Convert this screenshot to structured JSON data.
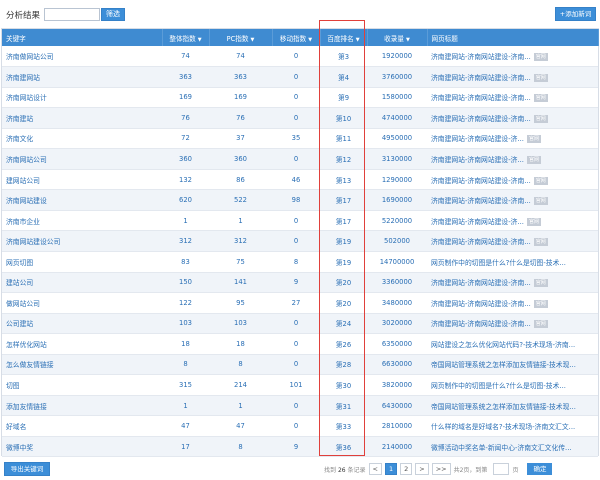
{
  "header": {
    "title": "分析结果",
    "filter_placeholder": "",
    "filter_button": "筛选",
    "add_button": "+添加新词"
  },
  "table": {
    "columns": [
      {
        "label": "关键字",
        "sort": ""
      },
      {
        "label": "整体指数",
        "sort": "▼"
      },
      {
        "label": "PC指数",
        "sort": "▼"
      },
      {
        "label": "移动指数",
        "sort": "▼"
      },
      {
        "label": "百度排名",
        "sort": "▼"
      },
      {
        "label": "收录量",
        "sort": "▼"
      },
      {
        "label": "网页标题",
        "sort": ""
      }
    ],
    "rows": [
      {
        "kw": "济南做网站公司",
        "all": "74",
        "pc": "74",
        "mobile": "0",
        "rank": "第3",
        "count": "1920000",
        "title": "济南建网站-济南网站建设-济南...",
        "tag": "官网"
      },
      {
        "kw": "济南建网站",
        "all": "363",
        "pc": "363",
        "mobile": "0",
        "rank": "第4",
        "count": "3760000",
        "title": "济南建网站-济南网站建设-济南...",
        "tag": "官网"
      },
      {
        "kw": "济南网站设计",
        "all": "169",
        "pc": "169",
        "mobile": "0",
        "rank": "第9",
        "count": "1580000",
        "title": "济南建网站-济南网站建设-济南...",
        "tag": "官网"
      },
      {
        "kw": "济南建站",
        "all": "76",
        "pc": "76",
        "mobile": "0",
        "rank": "第10",
        "count": "4740000",
        "title": "济南建网站-济南网站建设-济南...",
        "tag": "官网"
      },
      {
        "kw": "济南文化",
        "all": "72",
        "pc": "37",
        "mobile": "35",
        "rank": "第11",
        "count": "4950000",
        "title": "济南建网站-济南网站建设-济...",
        "tag": "官网"
      },
      {
        "kw": "济南网站公司",
        "all": "360",
        "pc": "360",
        "mobile": "0",
        "rank": "第12",
        "count": "3130000",
        "title": "济南建网站-济南网站建设-济...",
        "tag": "官网"
      },
      {
        "kw": "建网站公司",
        "all": "132",
        "pc": "86",
        "mobile": "46",
        "rank": "第13",
        "count": "1290000",
        "title": "济南建网站-济南网站建设-济南...",
        "tag": "官网"
      },
      {
        "kw": "济南网站建设",
        "all": "620",
        "pc": "522",
        "mobile": "98",
        "rank": "第17",
        "count": "1690000",
        "title": "济南建网站-济南网站建设-济南...",
        "tag": "官网"
      },
      {
        "kw": "济南市企业",
        "all": "1",
        "pc": "1",
        "mobile": "0",
        "rank": "第17",
        "count": "5220000",
        "title": "济南建网站-济南网站建设-济...",
        "tag": "官网"
      },
      {
        "kw": "济南网站建设公司",
        "all": "312",
        "pc": "312",
        "mobile": "0",
        "rank": "第19",
        "count": "502000",
        "title": "济南建网站-济南网站建设-济南...",
        "tag": "官网"
      },
      {
        "kw": "网页切图",
        "all": "83",
        "pc": "75",
        "mobile": "8",
        "rank": "第19",
        "count": "14700000",
        "title": "网页制作中的切图是什么?什么是切图-技术...",
        "tag": ""
      },
      {
        "kw": "建站公司",
        "all": "150",
        "pc": "141",
        "mobile": "9",
        "rank": "第20",
        "count": "3360000",
        "title": "济南建网站-济南网站建设-济南...",
        "tag": "官网"
      },
      {
        "kw": "做网站公司",
        "all": "122",
        "pc": "95",
        "mobile": "27",
        "rank": "第20",
        "count": "3480000",
        "title": "济南建网站-济南网站建设-济南...",
        "tag": "官网"
      },
      {
        "kw": "公司建站",
        "all": "103",
        "pc": "103",
        "mobile": "0",
        "rank": "第24",
        "count": "3020000",
        "title": "济南建网站-济南网站建设-济南...",
        "tag": "官网"
      },
      {
        "kw": "怎样优化网站",
        "all": "18",
        "pc": "18",
        "mobile": "0",
        "rank": "第26",
        "count": "6350000",
        "title": "网站建设之怎么优化网站代码?-技术现场-济南...",
        "tag": ""
      },
      {
        "kw": "怎么做友情链接",
        "all": "8",
        "pc": "8",
        "mobile": "0",
        "rank": "第28",
        "count": "6630000",
        "title": "帝国网站管理系统之怎样添加友情链接-技术现...",
        "tag": ""
      },
      {
        "kw": "切图",
        "all": "315",
        "pc": "214",
        "mobile": "101",
        "rank": "第30",
        "count": "3820000",
        "title": "网页制作中的切图是什么?什么是切图-技术...",
        "tag": ""
      },
      {
        "kw": "添加友情链接",
        "all": "1",
        "pc": "1",
        "mobile": "0",
        "rank": "第31",
        "count": "6430000",
        "title": "帝国网站管理系统之怎样添加友情链接-技术现...",
        "tag": ""
      },
      {
        "kw": "好域名",
        "all": "47",
        "pc": "47",
        "mobile": "0",
        "rank": "第33",
        "count": "2810000",
        "title": "什么样的域名是好域名?-技术现场-济南文汇文...",
        "tag": ""
      },
      {
        "kw": "微博中奖",
        "all": "17",
        "pc": "8",
        "mobile": "9",
        "rank": "第36",
        "count": "2140000",
        "title": "微博活动中奖名单-新闻中心-济南文汇文化传...",
        "tag": ""
      }
    ]
  },
  "footer": {
    "export_button": "导出关键词",
    "found_prefix": "找到",
    "found_total": "26",
    "found_suffix": "条记录",
    "prev": "<",
    "page1": "1",
    "page2": "2",
    "next": ">",
    "last": ">>",
    "pages_text": "共2页，到第",
    "page_suffix": "页",
    "go_button": "确定"
  },
  "colors": {
    "accent": "#3c8ed8",
    "header_bg": "#3f8bd1",
    "highlight_border": "#e0403b"
  }
}
